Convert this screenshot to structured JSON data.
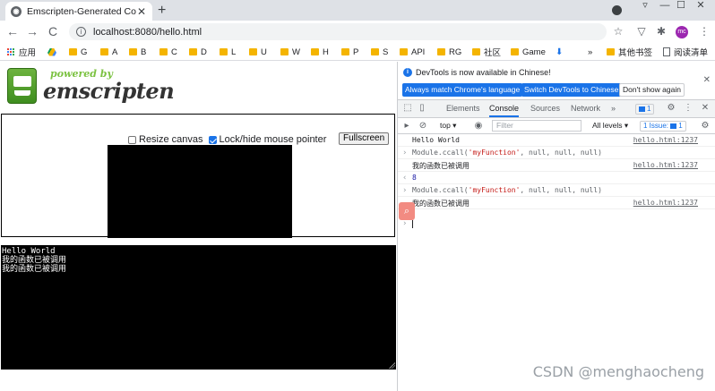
{
  "tab": {
    "title": "Emscripten-Generated Code",
    "close": "✕",
    "new_tab": "+"
  },
  "window": {
    "minimize": "—",
    "maximize": "☐",
    "close": "✕"
  },
  "toolbar": {
    "back": "←",
    "forward": "→",
    "reload": "C",
    "url": "localhost:8080/hello.html",
    "avatar": "mc"
  },
  "bookmarks": {
    "apps": "应用",
    "items": [
      "G",
      "A",
      "B",
      "C",
      "D",
      "L",
      "U",
      "W",
      "H",
      "P",
      "S",
      "API",
      "RG",
      "社区",
      "Game"
    ],
    "overflow": "»",
    "other": "其他书签",
    "reading": "阅读清单"
  },
  "page": {
    "logo_powered": "powered by",
    "logo_brand": "emscripten",
    "resize_label": "Resize canvas",
    "resize_checked": false,
    "lock_label": "Lock/hide mouse pointer",
    "lock_checked": true,
    "fullscreen_label": "Fullscreen",
    "output_lines": [
      "Hello World",
      "我的函数已被调用",
      "我的函数已被调用"
    ]
  },
  "devtools": {
    "info_message": "DevTools is now available in Chinese!",
    "btn_match": "Always match Chrome's language",
    "btn_switch": "Switch DevTools to Chinese",
    "btn_dismiss": "Don't show again",
    "tabs": [
      "Elements",
      "Console",
      "Sources",
      "Network"
    ],
    "active_tab": "Console",
    "more_tabs": "»",
    "issues_badge": "1",
    "context": "top ▾",
    "filter_placeholder": "Filter",
    "levels": "All levels ▾",
    "issue_count": "1 Issue:",
    "issue_flag": "1",
    "console": [
      {
        "type": "log",
        "text": "Hello World",
        "source": "hello.html:1237"
      },
      {
        "type": "input",
        "prefix": "Module.ccall(",
        "arg": "'myFunction'",
        "rest": ", null, null, null)",
        "source": ""
      },
      {
        "type": "log",
        "text": "我的函数已被调用",
        "source": "hello.html:1237"
      },
      {
        "type": "return",
        "text": "8",
        "source": ""
      },
      {
        "type": "input",
        "prefix": "Module.ccall(",
        "arg": "'myFunction'",
        "rest": ", null, null, null)",
        "source": ""
      },
      {
        "type": "log",
        "text": "我的函数已被调用",
        "source": "hello.html:1237"
      }
    ]
  },
  "watermark": "CSDN @menghaocheng"
}
